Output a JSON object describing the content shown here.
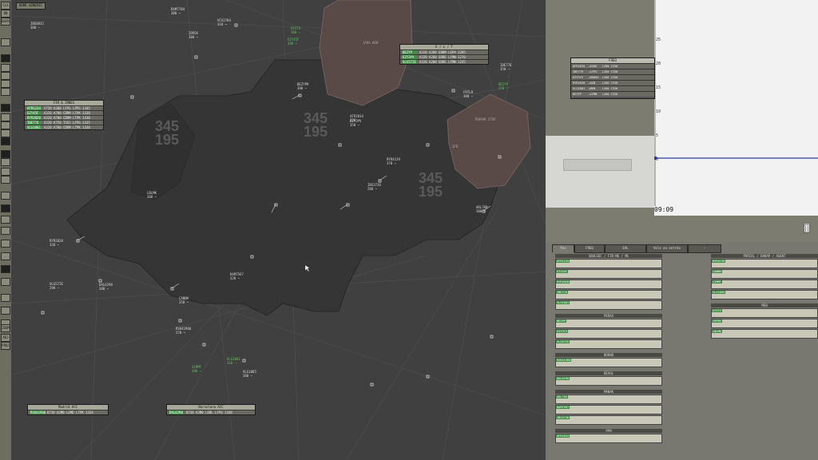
{
  "toolbar": {
    "top_labels": [
      "CLS",
      "ON",
      "BACK"
    ],
    "buttons": [
      "",
      "",
      "",
      "",
      "",
      "",
      "",
      "",
      "",
      "",
      "",
      "",
      "",
      "",
      "",
      "",
      "",
      "",
      "",
      "",
      "",
      "",
      "",
      "",
      "",
      ""
    ],
    "bottom_labels": [
      "ZOOM",
      "ADJ",
      "PROJ"
    ]
  },
  "radar": {
    "top_button": "HOME GENERIC",
    "sector_labels": [
      {
        "top": "345",
        "bottom": "195"
      },
      {
        "top": "345",
        "bottom": "195"
      },
      {
        "top": "345",
        "bottom": "195"
      }
    ],
    "airspace_labels": [
      "JAKA NEW",
      "TRAPAR STOP",
      "ZFR"
    ],
    "aircraft_tags": [
      {
        "line1": "RAM774H",
        "line2": "300 ~"
      },
      {
        "line1": "IBE8032",
        "line2": "380 ~"
      },
      {
        "line1": "29PEK",
        "line2": "380 ~"
      },
      {
        "line1": "VCX2784",
        "line2": "310 ~"
      },
      {
        "line1": "AYSTV",
        "line2": "360 ~"
      },
      {
        "line1": "EZY45F",
        "line2": "380 ~"
      },
      {
        "line1": "BEZYPK",
        "line2": "380 ~"
      },
      {
        "line1": "EZY3YV",
        "line2": "350 ~"
      },
      {
        "line1": "FRTLR",
        "line2": "380 ~"
      },
      {
        "line1": "IBE776",
        "line2": "350 ~"
      },
      {
        "line1": "BEZYP",
        "line2": "350 ~"
      },
      {
        "line1": "ARL709",
        "line2": "380 ~"
      },
      {
        "line1": "LBLMK",
        "line2": "380 ~"
      },
      {
        "line1": "RAM7567",
        "line2": "320 ~"
      },
      {
        "line1": "CANNH",
        "line2": "350 ~"
      },
      {
        "line1": "DAL6290",
        "line2": "380 ~"
      },
      {
        "line1": "VLG57IE",
        "line2": "290 ~"
      },
      {
        "line1": "RSK41960",
        "line2": "370 ~"
      },
      {
        "line1": "SIMMT",
        "line2": "380 ~"
      },
      {
        "line1": "VLG1001",
        "line2": "310 ~"
      },
      {
        "line1": "VLG1005",
        "line2": "380 ~"
      },
      {
        "line1": "RYR2020",
        "line2": "330 ~"
      },
      {
        "line1": "IBS3736",
        "line2": "280 ~"
      },
      {
        "line1": "AFR2034",
        "line2": "320 ~"
      },
      {
        "line1": "RYR4139",
        "line2": "370 ~"
      }
    ],
    "panels": [
      {
        "title": "FIR & ZONES",
        "rows": [
          {
            "callsign": "AFR1234",
            "text": "CF50 A200 LFPG LPPG 1345"
          },
          {
            "callsign": "EZY45F",
            "text": "A320 A780 CDRM LTPK 1330"
          },
          {
            "callsign": "RYR2020",
            "text": "A320 A780 CDRM LTPK 1330"
          },
          {
            "callsign": "IBE776",
            "text": "A320 A750 TSS2 LFPG 1335"
          },
          {
            "callsign": "VLG1001",
            "text": "A320 A780 CDRM LTPK 1330"
          }
        ]
      },
      {
        "title": "E / L / T",
        "rows": [
          {
            "callsign": "BEZYP",
            "text": "A320 A280 EBBM LEPA 1285"
          },
          {
            "callsign": "EZY3YV",
            "text": "A320 A280 EDRE LFMN 1270"
          },
          {
            "callsign": "VLG57IE",
            "text": "A320 A280 EDRE LFMN 1245"
          }
        ]
      },
      {
        "title": "Madrid ACC",
        "rows": [
          {
            "callsign": "RSK41960",
            "text": "B738 A2M0 LEMD LTPK 1334"
          }
        ]
      },
      {
        "title": "Barcelona ACC",
        "rows": [
          {
            "callsign": "DAL6290",
            "text": "B738 A2M0 LEBL LFPG 1340"
          }
        ]
      }
    ]
  },
  "right": {
    "timeline_ticks": [
      "25",
      "20",
      "15",
      "10",
      "5",
      "0"
    ],
    "clock": "09:09",
    "freq": {
      "title": "FREQ",
      "rows": [
        "AFR2034  →EGKK   L200 C330",
        "IBE776   →LFPG   L200 C330",
        "EZY3YV   →RODOX  L200 C330",
        "RYR2020  →AGN    L200 C330",
        "VLG1001  →MEN    L200 C330",
        "BEZYP    →LFMN   L200 C330"
      ]
    },
    "tabs": [
      "Pos",
      "FREQ",
      "EVL",
      "Vols en entrée",
      "—"
    ],
    "bays_left": [
      {
        "title": "SOULSEC / FIR-NE / ML",
        "strips": 5
      },
      {
        "title": "PERAX",
        "strips": 3
      },
      {
        "title": "BOKNO",
        "strips": 1
      },
      {
        "title": "BEVOL",
        "strips": 1
      },
      {
        "title": "MANAK",
        "strips": 3
      },
      {
        "title": "PPN",
        "strips": 1
      }
    ],
    "bays_right": [
      {
        "title": "PORCOL / BAKAP / AGENT",
        "strips": 4
      },
      {
        "title": "MEN",
        "strips": 3
      }
    ],
    "strip_callsigns": [
      "AFR1234",
      "EZY45F",
      "RYR2020",
      "IBE776",
      "VLG1001",
      "BEZYP",
      "EZY3YV",
      "VLG57IE",
      "RSK41960",
      "DAL6290",
      "ARL709",
      "RAM7567",
      "IBS3736",
      "AFR2034",
      "RYR4139",
      "CANNH",
      "SIMMT",
      "VLG1005",
      "AYSTV",
      "29PEK",
      "LBLMK",
      "FRTLR"
    ],
    "colors": {
      "callsign_bg": "#3f8e44",
      "warn": "#c04a34",
      "strip_bg": "#c9c8b8"
    }
  }
}
